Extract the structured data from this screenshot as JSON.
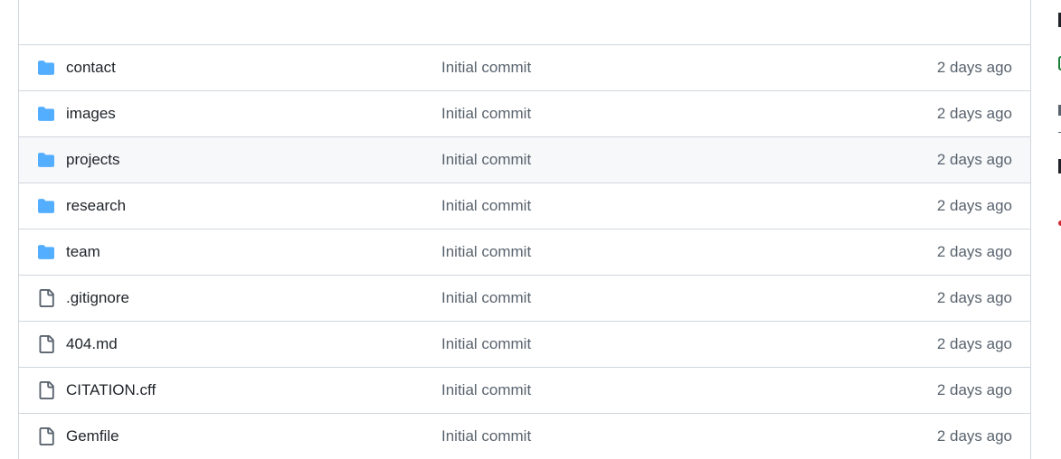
{
  "files": [
    {
      "name": "contact",
      "type": "folder",
      "icon": "folder-icon",
      "commit": "Initial commit",
      "age": "2 days ago"
    },
    {
      "name": "images",
      "type": "folder",
      "icon": "folder-icon",
      "commit": "Initial commit",
      "age": "2 days ago"
    },
    {
      "name": "projects",
      "type": "folder",
      "icon": "folder-icon",
      "commit": "Initial commit",
      "age": "2 days ago"
    },
    {
      "name": "research",
      "type": "folder",
      "icon": "folder-icon",
      "commit": "Initial commit",
      "age": "2 days ago"
    },
    {
      "name": "team",
      "type": "folder",
      "icon": "folder-icon",
      "commit": "Initial commit",
      "age": "2 days ago"
    },
    {
      "name": ".gitignore",
      "type": "file",
      "icon": "file-icon",
      "commit": "Initial commit",
      "age": "2 days ago"
    },
    {
      "name": "404.md",
      "type": "file",
      "icon": "file-icon",
      "commit": "Initial commit",
      "age": "2 days ago"
    },
    {
      "name": "CITATION.cff",
      "type": "file",
      "icon": "file-icon",
      "commit": "Initial commit",
      "age": "2 days ago"
    },
    {
      "name": "Gemfile",
      "type": "file",
      "icon": "file-icon",
      "commit": "Initial commit",
      "age": "2 days ago"
    }
  ],
  "colors": {
    "folder": "#54aeff",
    "file_icon": "#59636e",
    "border": "#d0d7de",
    "hover_row": "#f6f8fa",
    "muted_text": "#59636e",
    "text": "#1f2328"
  }
}
